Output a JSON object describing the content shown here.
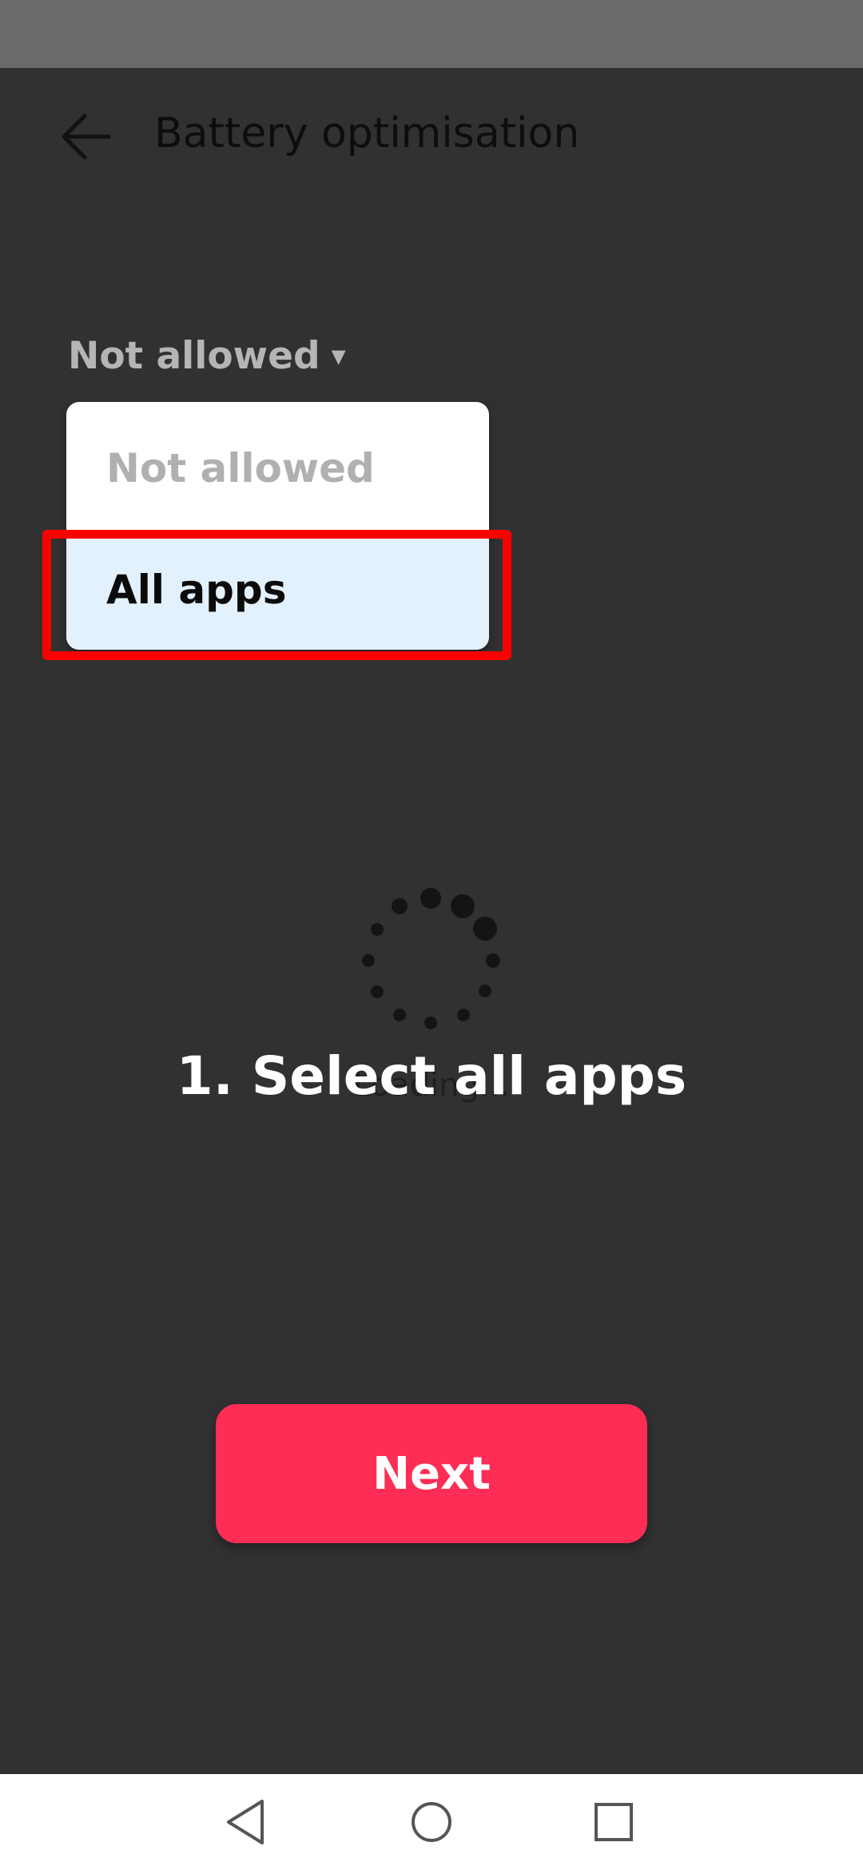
{
  "header": {
    "title": "Battery optimisation",
    "back_icon": "arrow-left-icon"
  },
  "filter": {
    "selected": "Not allowed",
    "caret": "▾",
    "options": [
      "Not allowed",
      "All apps"
    ],
    "highlighted_option": "All apps"
  },
  "loading": {
    "text": "Loading..."
  },
  "instruction": "1. Select all apps",
  "next_button": {
    "label": "Next"
  },
  "colors": {
    "background": "#313131",
    "accent": "#fe2d55",
    "highlight": "#fc0000",
    "selected_item": "#e3f1fd"
  },
  "nav": {
    "icons": [
      "triangle-back-icon",
      "circle-home-icon",
      "square-recents-icon"
    ]
  }
}
